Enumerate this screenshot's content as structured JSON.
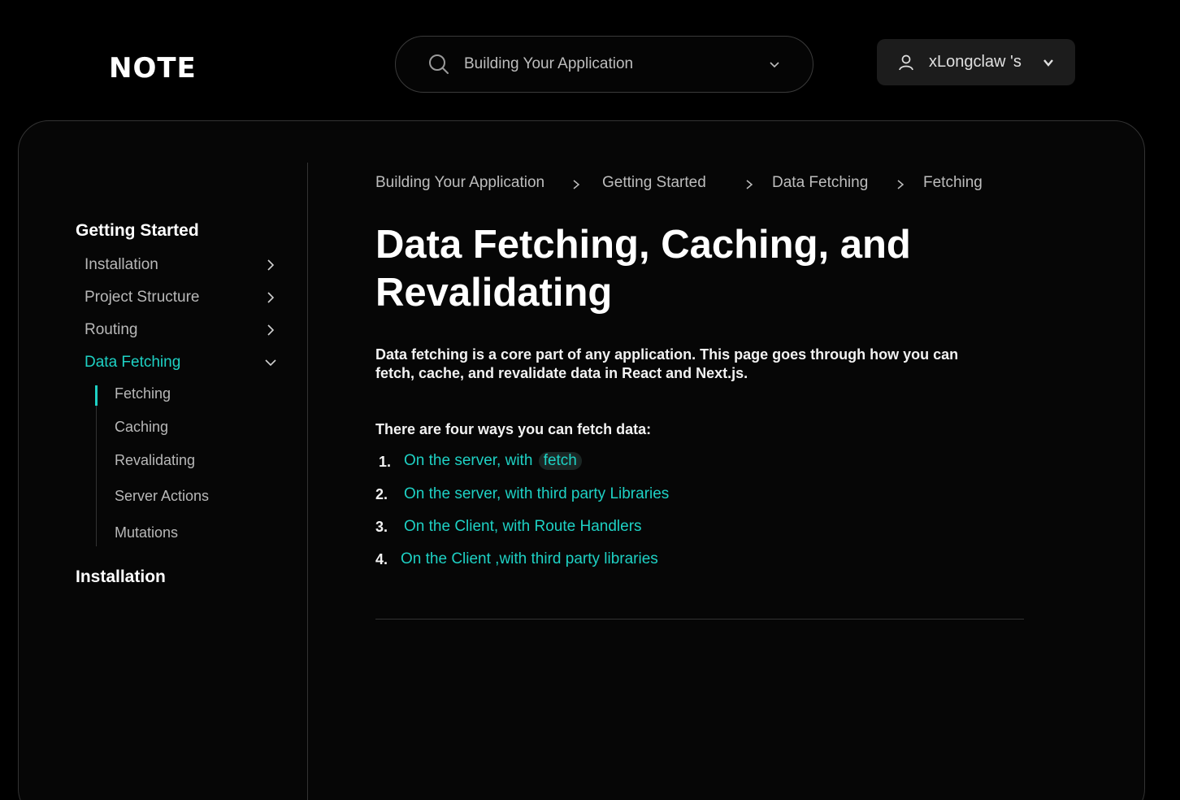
{
  "header": {
    "logo": "NOTE",
    "search": {
      "value": "Building Your Application",
      "icon": "search-icon"
    },
    "user": {
      "name": "xLongclaw 's",
      "icon": "user-icon"
    }
  },
  "sidebar": {
    "section_1": "Getting Started",
    "items": [
      {
        "label": "Installation",
        "expanded": false
      },
      {
        "label": "Project Structure",
        "expanded": false
      },
      {
        "label": "Routing",
        "expanded": false
      },
      {
        "label": "Data Fetching",
        "expanded": true,
        "active": true
      }
    ],
    "subitems": [
      "Fetching",
      "Caching",
      "Revalidating",
      "Server Actions",
      "Mutations"
    ],
    "section_2": "Installation"
  },
  "breadcrumb": [
    "Building Your Application",
    "Getting Started",
    "Data Fetching",
    "Fetching"
  ],
  "main": {
    "title_line1": "Data Fetching, Caching, and",
    "title_line2": "Revalidating",
    "intro_line1": "Data fetching is a core part of any application. This page goes through how you can",
    "intro_line2": "fetch, cache, and revalidate data in React and Next.js.",
    "ways_heading": "There are four ways you can fetch data:",
    "list": [
      {
        "num": "1.",
        "text": "On the server, with",
        "code": "fetch"
      },
      {
        "num": "2.",
        "text": "On the server, with third party Libraries"
      },
      {
        "num": "3.",
        "text": "On the Client, with Route Handlers"
      },
      {
        "num": "4.",
        "text": "On the Client ,with third party libraries"
      }
    ]
  },
  "colors": {
    "accent": "#1ed1c4",
    "background": "#000000",
    "panel": "#060606",
    "border": "#333333"
  }
}
